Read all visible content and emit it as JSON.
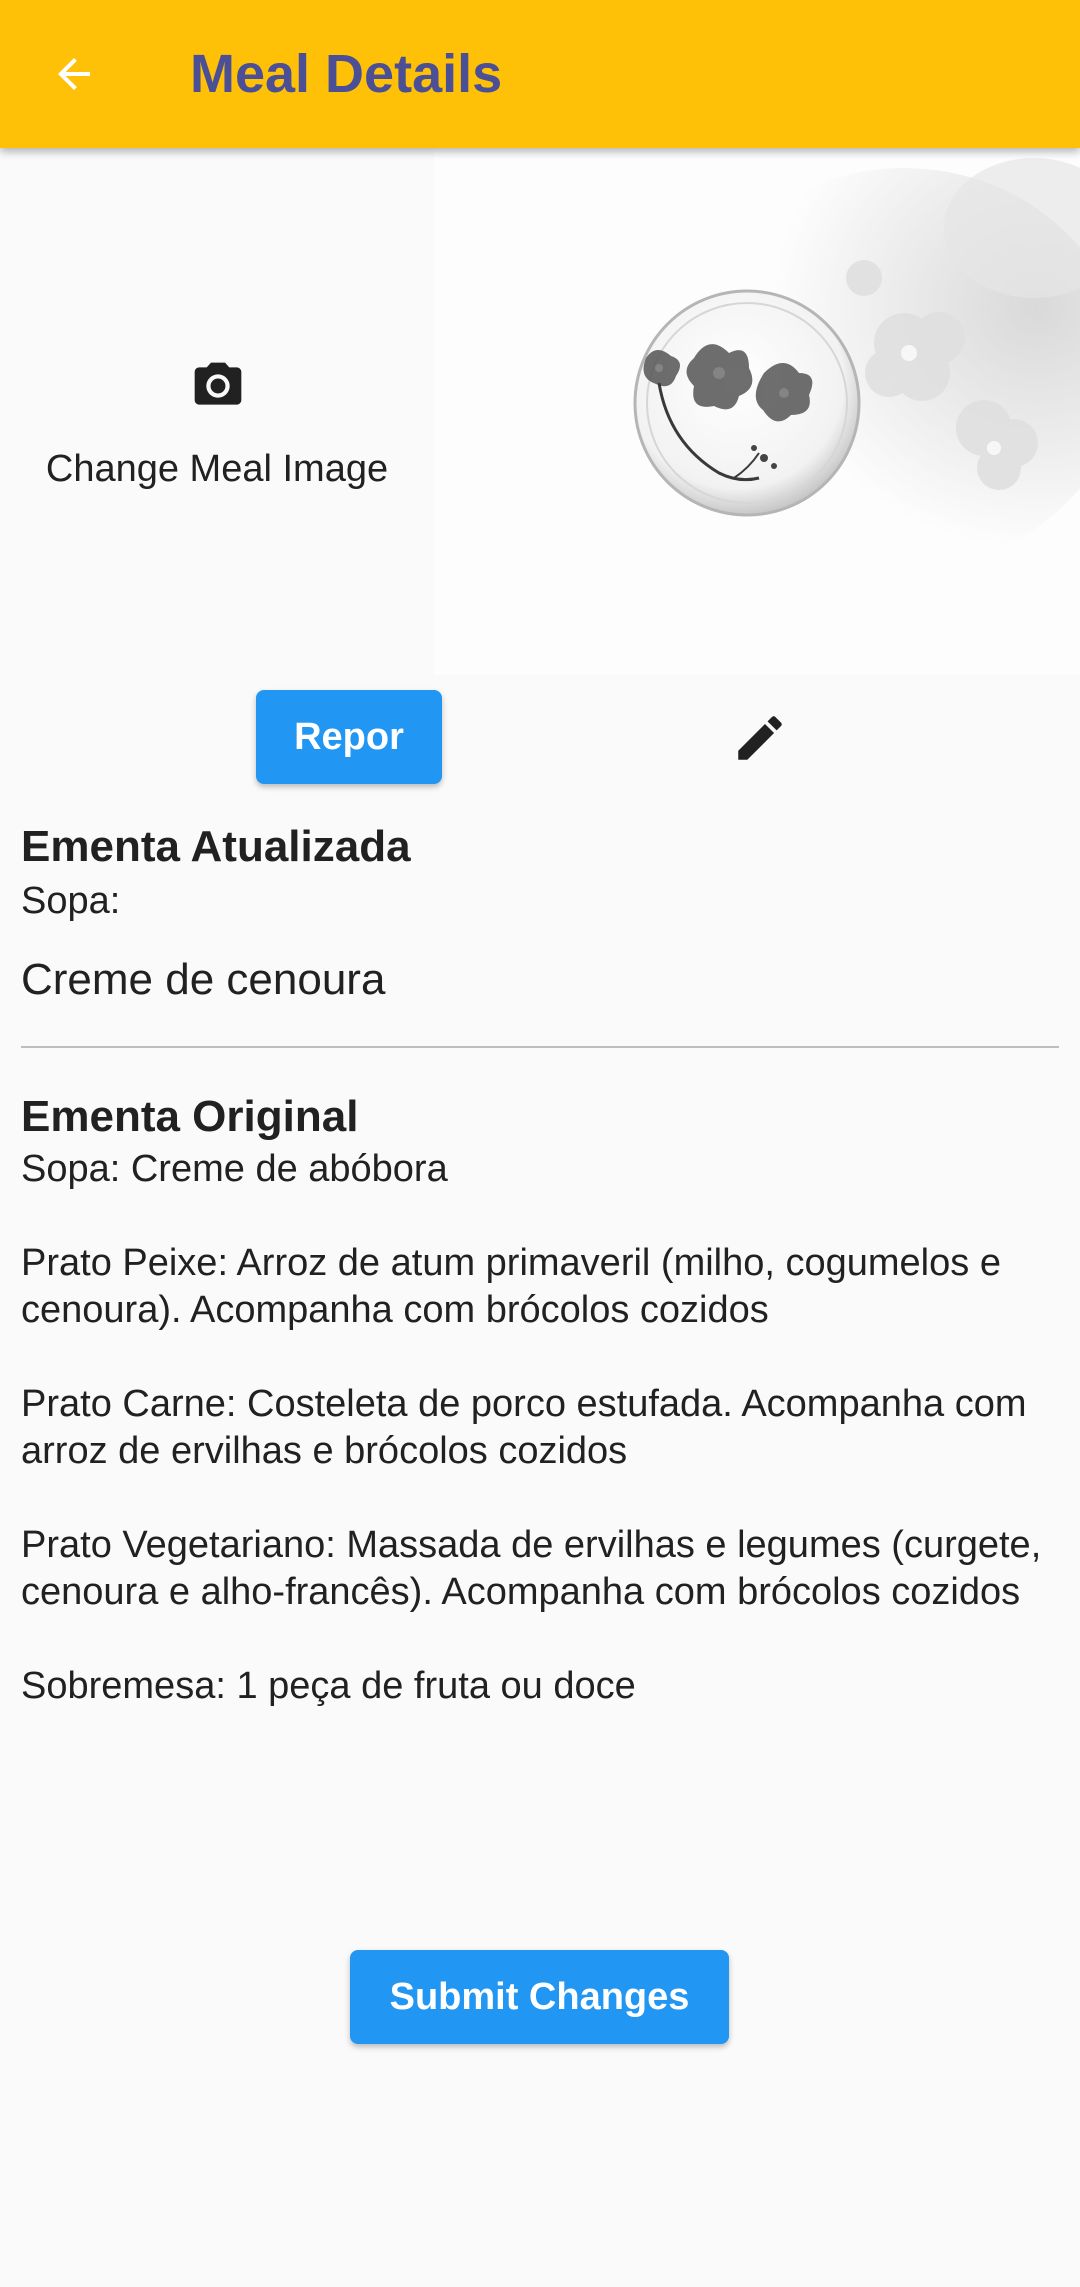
{
  "appbar": {
    "title": "Meal Details",
    "back_icon": "arrow-back-icon",
    "background_color": "#ffc107",
    "title_color": "#4a4f96"
  },
  "image_section": {
    "change_label": "Change Meal Image",
    "camera_icon": "camera-icon",
    "image_description": "grayscale-flower-plate-photo"
  },
  "actions": {
    "repor_label": "Repor",
    "edit_icon": "pencil-edit-icon",
    "submit_label": "Submit Changes",
    "button_color": "#2196f3"
  },
  "updated_menu": {
    "title": "Ementa Atualizada",
    "soup_label": "Sopa:",
    "soup_value": "Creme de cenoura"
  },
  "original_menu": {
    "title": "Ementa Original",
    "lines": [
      "Sopa: Creme de abóbora",
      "",
      "Prato Peixe: Arroz de atum primaveril (milho, cogumelos e cenoura). Acompanha com brócolos cozidos",
      "",
      "Prato Carne: Costeleta de porco estufada. Acompanha com arroz de ervilhas e brócolos cozidos",
      "",
      "Prato Vegetariano: Massada de ervilhas e legumes (curgete, cenoura e alho-francês). Acompanha com brócolos cozidos",
      "",
      "Sobremesa: 1 peça de fruta ou doce"
    ]
  }
}
